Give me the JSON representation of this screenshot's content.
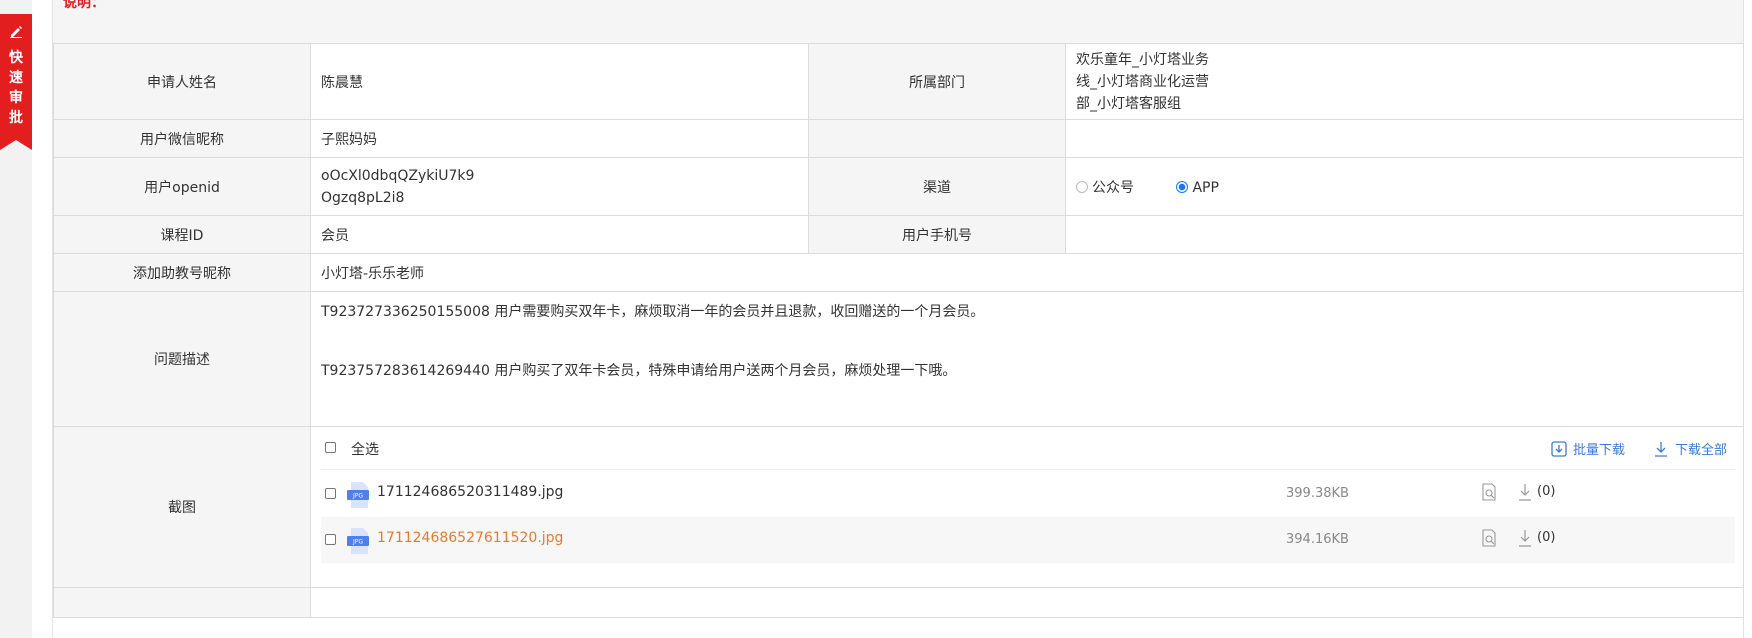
{
  "sidebar": {
    "quick_approve": "快速审批"
  },
  "note": {
    "label": "说明："
  },
  "form": {
    "applicant_label": "申请人姓名",
    "applicant_value": "陈晨慧",
    "dept_label": "所属部门",
    "dept_lines": [
      "欢乐童年_小灯塔业务",
      "线_小灯塔商业化运营",
      "部_小灯塔客服组"
    ],
    "wechat_label": "用户微信昵称",
    "wechat_value": "子熙妈妈",
    "openid_label": "用户openid",
    "openid_lines": [
      "oOcXl0dbqQZykiU7k9",
      "Ogzq8pL2i8"
    ],
    "channel_label": "渠道",
    "channel_options": [
      "公众号",
      "APP"
    ],
    "channel_selected": "APP",
    "course_label": "课程ID",
    "course_value": "会员",
    "phone_label": "用户手机号",
    "phone_value": "",
    "assistant_label": "添加助教号昵称",
    "assistant_value": "小灯塔-乐乐老师",
    "problem_label": "问题描述",
    "problem_lines": [
      "T923727336250155008  用户需要购买双年卡，麻烦取消一年的会员并且退款，收回赠送的一个月会员。",
      "T923757283614269440   用户购买了双年卡会员，特殊申请给用户送两个月会员，麻烦处理一下哦。"
    ],
    "screenshot_label": "截图"
  },
  "attachments": {
    "select_all": "全选",
    "batch_download": "批量下载",
    "download_all": "下载全部",
    "icon_type": "JPG",
    "files": [
      {
        "name": "171124686520311489.jpg",
        "size": "399.38KB",
        "downloads": "(0)"
      },
      {
        "name": "171124686527611520.jpg",
        "size": "394.16KB",
        "downloads": "(0)"
      }
    ]
  },
  "colors": {
    "accent_red": "#e31e1e",
    "link_blue": "#3a7bd5",
    "highlight_orange": "#e87a2e"
  }
}
